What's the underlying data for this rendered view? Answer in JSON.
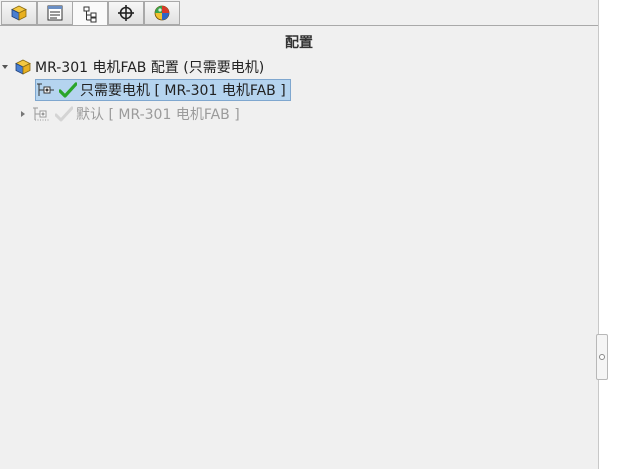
{
  "tabs": [
    {
      "icon": "feature-manager-icon",
      "active": false
    },
    {
      "icon": "property-manager-icon",
      "active": false
    },
    {
      "icon": "configuration-manager-icon",
      "active": true
    },
    {
      "icon": "dimxpert-icon",
      "active": false
    },
    {
      "icon": "display-manager-icon",
      "active": false
    }
  ],
  "panel": {
    "title": "配置"
  },
  "tree": {
    "root": {
      "label": "MR-301 电机FAB 配置 (只需要电机)",
      "expanded": true
    },
    "items": [
      {
        "label": "只需要电机 [ MR-301 电机FAB ]",
        "active": true,
        "selected": true
      },
      {
        "label": "默认 [ MR-301 电机FAB ]",
        "active": false,
        "selected": false
      }
    ]
  },
  "colors": {
    "selection_bg": "#b5d4ef",
    "check_green": "#2aa52a",
    "inactive_text": "#9b9b9b"
  }
}
